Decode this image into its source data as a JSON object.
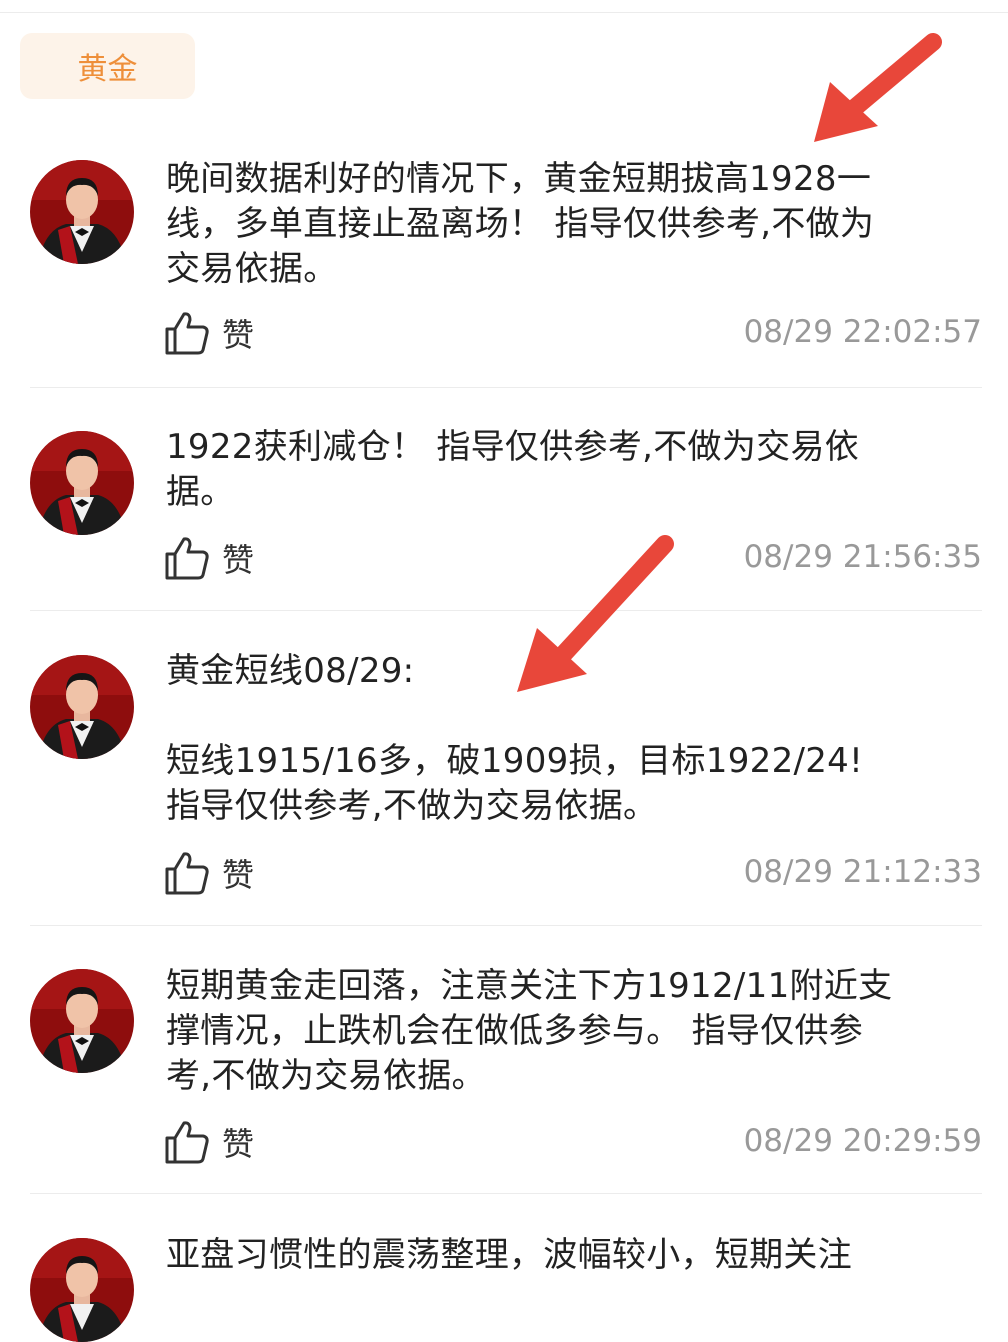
{
  "category_tag": "黄金",
  "like_label": "赞",
  "posts": [
    {
      "text": "晚间数据利好的情况下，黄金短期拔高1928一\n线，多单直接止盈离场！ 指导仅供参考,不做为\n交易依据。",
      "time": "08/29 22:02:57"
    },
    {
      "text": "1922获利减仓！ 指导仅供参考,不做为交易依\n据。",
      "time": "08/29 21:56:35"
    },
    {
      "text": "黄金短线08/29:\n\n短线1915/16多，破1909损，目标1922/24!\n指导仅供参考,不做为交易依据。",
      "time": "08/29 21:12:33"
    },
    {
      "text": "短期黄金走回落，注意关注下方1912/11附近支\n撑情况，止跌机会在做低多参与。 指导仅供参\n考,不做为交易依据。",
      "time": "08/29 20:29:59"
    },
    {
      "text": "亚盘习惯性的震荡整理，波幅较小，短期关注",
      "time": ""
    }
  ],
  "colors": {
    "accent": "#ee8f3a",
    "tag_bg": "#fdf3e9",
    "arrow": "#e8473a",
    "time": "#999999"
  }
}
